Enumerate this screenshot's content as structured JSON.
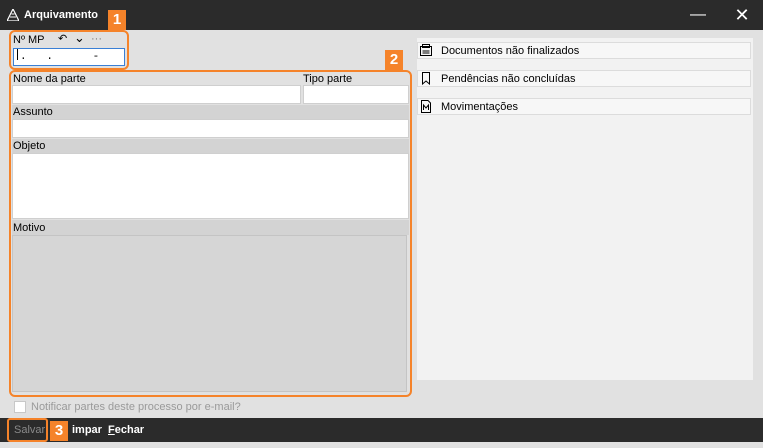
{
  "window": {
    "title": "Arquivamento",
    "minimize_glyph": "—",
    "close_glyph": "✕"
  },
  "markers": [
    "1",
    "2",
    "3"
  ],
  "mp": {
    "label": "Nº MP",
    "undo_glyph": "↶",
    "dropdown_glyph": "⌄",
    "more_glyph": "···",
    "input_mask": ".   .      -"
  },
  "form": {
    "nome_da_parte_label": "Nome da parte",
    "tipo_parte_label": "Tipo parte",
    "assunto_label": "Assunto",
    "objeto_label": "Objeto",
    "motivo_label": "Motivo"
  },
  "right_panel": {
    "items": [
      {
        "label": "Documentos não finalizados",
        "icon": "printer-folder-icon"
      },
      {
        "label": "Pendências não concluídas",
        "icon": "bookmark-icon"
      },
      {
        "label": "Movimentações",
        "icon": "document-m-icon"
      }
    ]
  },
  "notify": {
    "label": "Notificar partes deste processo por e-mail?"
  },
  "toolbar": {
    "salvar_label": "Salvar",
    "limpar_rest": "impar",
    "fechar_first": "F",
    "fechar_rest": "echar"
  },
  "colors": {
    "accent": "#f5832a",
    "titlebar": "#2b2b2b",
    "focus_border": "#3a7fd5"
  }
}
